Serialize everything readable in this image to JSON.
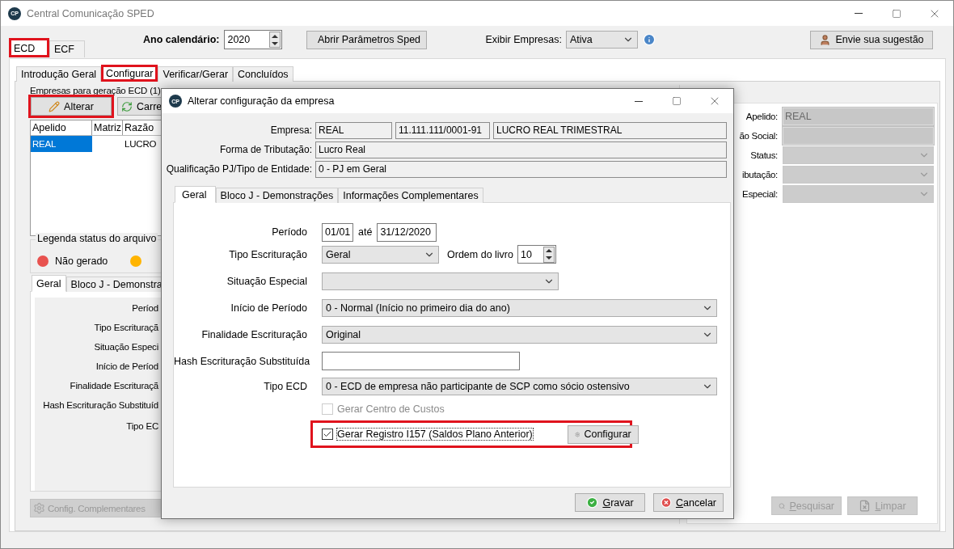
{
  "window": {
    "logo": "CP",
    "title": "Central Comunicação SPED"
  },
  "book_tabs": [
    {
      "label": "ECD",
      "selected": true,
      "highlighted": true
    },
    {
      "label": "ECF",
      "selected": false,
      "highlighted": false
    }
  ],
  "toolbar": {
    "year_label": "Ano calendário:",
    "year": "2020",
    "params_button": "Abrir Parâmetros Sped",
    "show_label": "Exibir Empresas:",
    "show_value": "Ativa",
    "suggest_button": "Envie sua sugestão"
  },
  "step_tabs": [
    {
      "label": "Introdução Geral",
      "selected": false,
      "highlighted": false
    },
    {
      "label": "Configurar",
      "selected": true,
      "highlighted": true
    },
    {
      "label": "Verificar/Gerar",
      "selected": false,
      "highlighted": false
    },
    {
      "label": "Concluídos",
      "selected": false,
      "highlighted": false
    }
  ],
  "companies": {
    "title": "Empresas para geração ECD (1)",
    "buttons": [
      {
        "label": "Alterar",
        "kind": "edit",
        "highlighted": true
      },
      {
        "label": "Carre",
        "kind": "reload",
        "highlighted": false
      }
    ],
    "columns": [
      "Apelido",
      "Matriz",
      "Razão"
    ],
    "rows": [
      {
        "apelido": "REAL",
        "razao": "LUCRO",
        "selected": true
      }
    ]
  },
  "legend": {
    "title": "Legenda status do arquivo",
    "items": [
      {
        "label": "Não gerado",
        "color": "#e8524f"
      },
      {
        "color": "#ffb400"
      }
    ]
  },
  "detail_tabs": [
    {
      "label": "Geral",
      "selected": true
    },
    {
      "label": "Bloco J - Demonstra",
      "selected": false
    }
  ],
  "detail_labels": [
    "Períod",
    "Tipo Escrituraçã",
    "Situação Especi",
    "Início de Períod",
    "Finalidade Escrituraçã",
    "Hash Escrituração Substituíd",
    "Tipo EC"
  ],
  "complementary_button": {
    "label": "Config. Complementares",
    "disabled": true
  },
  "filter": {
    "fields": [
      {
        "label": "Apelido:",
        "kind": "text",
        "value": "REAL",
        "disabled": true
      },
      {
        "label": "ão Social:",
        "kind": "text"
      },
      {
        "label": "Status:",
        "kind": "select"
      },
      {
        "label": "ibutação:",
        "kind": "select"
      },
      {
        "label": "Especial:",
        "kind": "select"
      }
    ],
    "buttons": [
      {
        "label": "Pesquisar",
        "kind": "search",
        "disabled": true
      },
      {
        "label": "Limpar",
        "kind": "clear",
        "disabled": true
      }
    ]
  },
  "dialog": {
    "logo": "CP",
    "title": "Alterar configuração da empresa",
    "header_fields": [
      {
        "label": "Empresa:",
        "values": [
          "REAL",
          "11.111.111/0001-91",
          "LUCRO REAL TRIMESTRAL"
        ]
      },
      {
        "label": "Forma de Tributação:",
        "values": [
          "Lucro Real"
        ]
      },
      {
        "label": "Qualificação PJ/Tipo de Entidade:",
        "values": [
          "0 - PJ em Geral"
        ]
      }
    ],
    "tabs": [
      {
        "label": "Geral",
        "selected": true
      },
      {
        "label": "Bloco J - Demonstrações",
        "selected": false
      },
      {
        "label": "Informações Complementares",
        "selected": false
      }
    ],
    "rows": [
      {
        "kind": "period",
        "label": "Período",
        "from": "01/01",
        "separator": "até",
        "to": "31/12/2020"
      },
      {
        "kind": "select_spin",
        "label": "Tipo Escrituração",
        "value": "Geral",
        "spin_label": "Ordem do livro",
        "spin_value": "10"
      },
      {
        "kind": "select",
        "label": "Situação Especial"
      },
      {
        "kind": "select",
        "label": "Início de Período",
        "value": "0 - Normal (Início no primeiro dia do ano)"
      },
      {
        "kind": "select",
        "label": "Finalidade Escrituração",
        "value": "Original"
      },
      {
        "kind": "text",
        "label": "Hash Escrituração Substituída"
      },
      {
        "kind": "select",
        "label": "Tipo ECD",
        "value": "0 - ECD de empresa não participante de SCP como sócio ostensivo"
      },
      {
        "kind": "checkbox",
        "label": "Gerar Centro de Custos",
        "checked": false,
        "disabled": true,
        "highlighted": false
      },
      {
        "kind": "checkbox",
        "label": "Gerar Registro I157 (Saldos Plano Anterior)",
        "checked": true,
        "disabled": false,
        "highlighted": true,
        "button": "Configurar"
      }
    ],
    "buttons": [
      {
        "label": "Gravar",
        "kind": "ok"
      },
      {
        "label": "Cancelar",
        "kind": "cancel"
      }
    ]
  }
}
